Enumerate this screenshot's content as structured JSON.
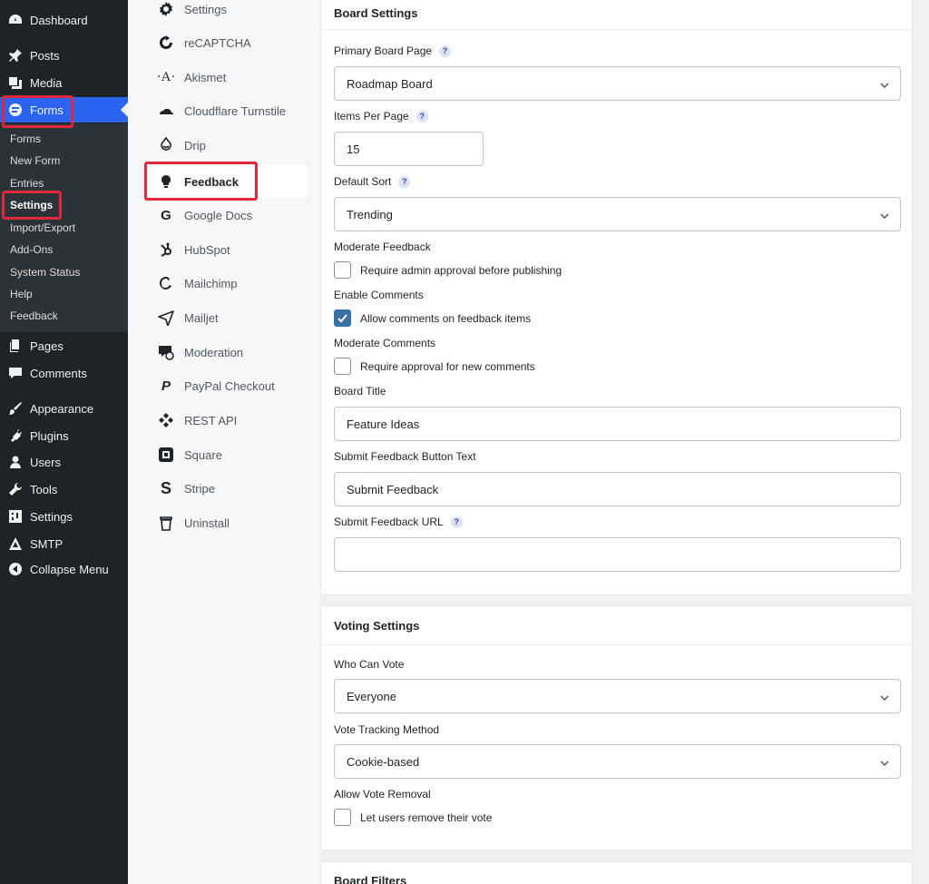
{
  "wp_menu": {
    "dashboard": "Dashboard",
    "posts": "Posts",
    "media": "Media",
    "forms": "Forms",
    "forms_submenu": [
      "Forms",
      "New Form",
      "Entries",
      "Settings",
      "Import/Export",
      "Add-Ons",
      "System Status",
      "Help",
      "Feedback"
    ],
    "pages": "Pages",
    "comments": "Comments",
    "appearance": "Appearance",
    "plugins": "Plugins",
    "users": "Users",
    "tools": "Tools",
    "settings": "Settings",
    "smtp": "SMTP",
    "collapse": "Collapse Menu"
  },
  "settings_nav": [
    "Settings",
    "reCAPTCHA",
    "Akismet",
    "Cloudflare Turnstile",
    "Drip",
    "Feedback",
    "Google Docs",
    "HubSpot",
    "Mailchimp",
    "Mailjet",
    "Moderation",
    "PayPal Checkout",
    "REST API",
    "Square",
    "Stripe",
    "Uninstall"
  ],
  "board_settings": {
    "title": "Board Settings",
    "primary_page_label": "Primary Board Page",
    "primary_page_value": "Roadmap Board",
    "items_per_page_label": "Items Per Page",
    "items_per_page_value": "15",
    "default_sort_label": "Default Sort",
    "default_sort_value": "Trending",
    "moderate_feedback_label": "Moderate Feedback",
    "moderate_feedback_option": "Require admin approval before publishing",
    "enable_comments_label": "Enable Comments",
    "enable_comments_option": "Allow comments on feedback items",
    "moderate_comments_label": "Moderate Comments",
    "moderate_comments_option": "Require approval for new comments",
    "board_title_label": "Board Title",
    "board_title_value": "Feature Ideas",
    "submit_text_label": "Submit Feedback Button Text",
    "submit_text_value": "Submit Feedback",
    "submit_url_label": "Submit Feedback URL",
    "submit_url_value": ""
  },
  "voting_settings": {
    "title": "Voting Settings",
    "who_can_vote_label": "Who Can Vote",
    "who_can_vote_value": "Everyone",
    "tracking_label": "Vote Tracking Method",
    "tracking_value": "Cookie-based",
    "allow_removal_label": "Allow Vote Removal",
    "allow_removal_option": "Let users remove their vote"
  },
  "board_filters": {
    "title": "Board Filters"
  },
  "help_mark": "?",
  "colors": {
    "sidebar_bg": "#1d2327",
    "submenu_bg": "#2c3338",
    "active_blue": "#2b64f1",
    "highlight_red": "#e0283a",
    "checkbox_checked": "#3871a4"
  }
}
